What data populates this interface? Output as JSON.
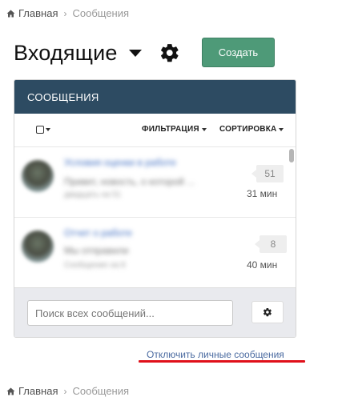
{
  "breadcrumb": {
    "home": "Главная",
    "current": "Сообщения"
  },
  "header": {
    "title": "Входящие",
    "create_label": "Создать"
  },
  "panel": {
    "title": "СООБЩЕНИЯ",
    "filter_label": "ФИЛЬТРАЦИЯ",
    "sort_label": "СОРТИРОВКА"
  },
  "messages": [
    {
      "count": "51",
      "time": "31 мин",
      "subject": "Условия оценки в работе",
      "preview": "Привет, новость, о которой ...",
      "meta": "двадцать на 51"
    },
    {
      "count": "8",
      "time": "40 мин",
      "subject": "Отчет о работе",
      "preview": "Мы отправили",
      "meta": "Сообщение на 8"
    }
  ],
  "search": {
    "placeholder": "Поиск всех сообщений..."
  },
  "footer_link": "Отключить личные сообщения",
  "colors": {
    "panel_header": "#2d4b62",
    "create_button": "#4e9a78",
    "link": "#4a6aa0",
    "annotation": "#e0101a"
  },
  "icons": {
    "home": "home-icon",
    "gear": "gear-icon",
    "caret": "caret-down-icon",
    "checkbox": "checkbox-icon"
  }
}
